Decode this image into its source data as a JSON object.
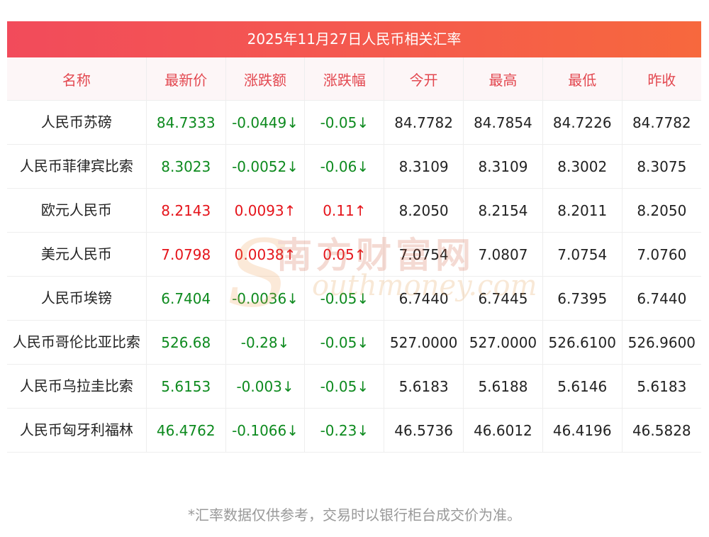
{
  "title": "2025年11月27日人民币相关汇率",
  "headers": [
    "名称",
    "最新价",
    "涨跌额",
    "涨跌幅",
    "今开",
    "最高",
    "最低",
    "昨收"
  ],
  "rows": [
    {
      "name": "人民币苏磅",
      "latest": "84.7333",
      "change": "-0.0449↓",
      "pct": "-0.05↓",
      "open": "84.7782",
      "high": "84.7854",
      "low": "84.7226",
      "prev": "84.7782",
      "dir": "down"
    },
    {
      "name": "人民币菲律宾比索",
      "latest": "8.3023",
      "change": "-0.0052↓",
      "pct": "-0.06↓",
      "open": "8.3109",
      "high": "8.3109",
      "low": "8.3002",
      "prev": "8.3075",
      "dir": "down"
    },
    {
      "name": "欧元人民币",
      "latest": "8.2143",
      "change": "0.0093↑",
      "pct": "0.11↑",
      "open": "8.2050",
      "high": "8.2154",
      "low": "8.2011",
      "prev": "8.2050",
      "dir": "up"
    },
    {
      "name": "美元人民币",
      "latest": "7.0798",
      "change": "0.0038↑",
      "pct": "0.05↑",
      "open": "7.0754",
      "high": "7.0807",
      "low": "7.0754",
      "prev": "7.0760",
      "dir": "up"
    },
    {
      "name": "人民币埃镑",
      "latest": "6.7404",
      "change": "-0.0036↓",
      "pct": "-0.05↓",
      "open": "6.7440",
      "high": "6.7445",
      "low": "6.7395",
      "prev": "6.7440",
      "dir": "down"
    },
    {
      "name": "人民币哥伦比亚比索",
      "latest": "526.68",
      "change": "-0.28↓",
      "pct": "-0.05↓",
      "open": "527.0000",
      "high": "527.0000",
      "low": "526.6100",
      "prev": "526.9600",
      "dir": "down"
    },
    {
      "name": "人民币乌拉圭比索",
      "latest": "5.6153",
      "change": "-0.003↓",
      "pct": "-0.05↓",
      "open": "5.6183",
      "high": "5.6188",
      "low": "5.6146",
      "prev": "5.6183",
      "dir": "down"
    },
    {
      "name": "人民币匈牙利福林",
      "latest": "46.4762",
      "change": "-0.1066↓",
      "pct": "-0.23↓",
      "open": "46.5736",
      "high": "46.6012",
      "low": "46.4196",
      "prev": "46.5828",
      "dir": "down"
    }
  ],
  "note": "*汇率数据仅供参考，交易时以银行柜台成交价为准。",
  "watermark": {
    "cn": "南方财富网",
    "en": "outhmoney.com",
    "s": "S"
  },
  "colors": {
    "up": "#e5141b",
    "down": "#0d8a1e",
    "header_text": "#e34850",
    "title_start": "#f24b5b",
    "title_end": "#f7683d"
  }
}
